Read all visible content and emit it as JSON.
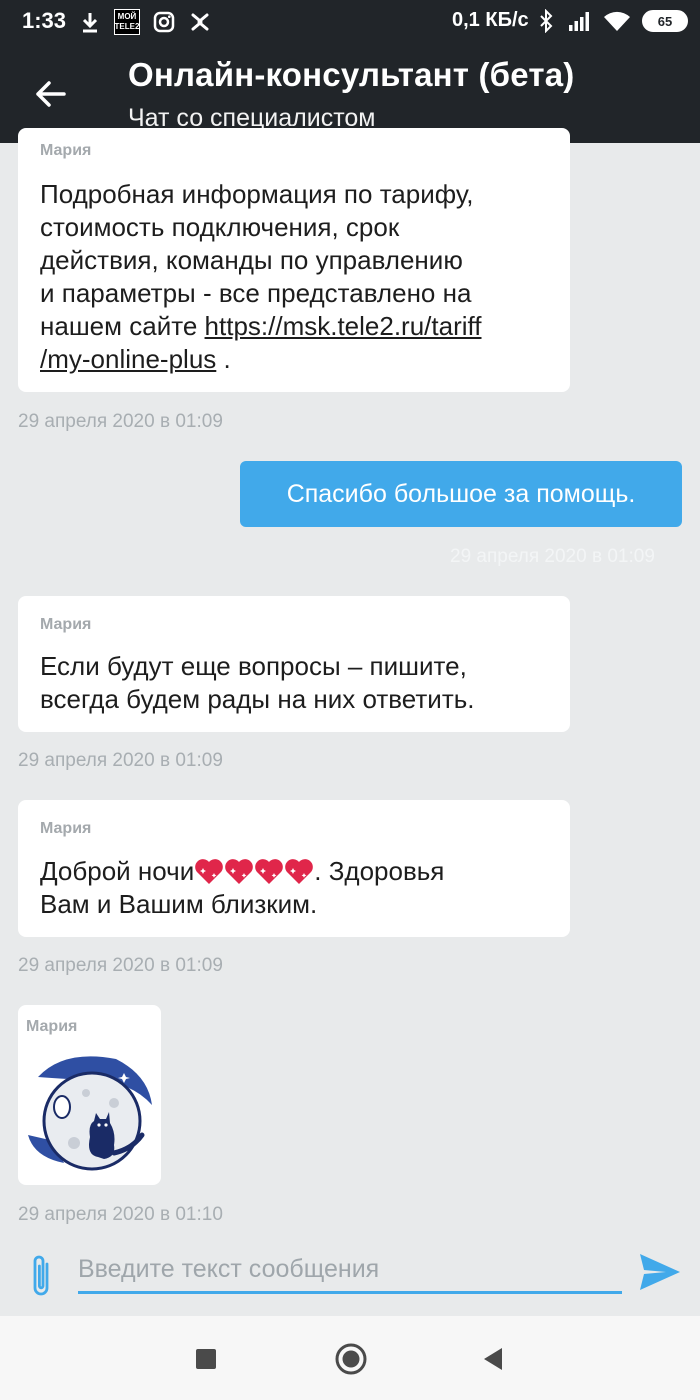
{
  "status_bar": {
    "time": "1:33",
    "operator_badge": "МОЙ TELE2",
    "network_speed": "0,1 КБ/с",
    "battery": "65"
  },
  "app_bar": {
    "title": "Онлайн-консультант (бета)",
    "subtitle": "Чат со специалистом"
  },
  "messages": [
    {
      "sender": "Мария",
      "text_line_1": "Подробная информация по тарифу,",
      "text_line_2": "стоимость  подключения, срок",
      "text_line_3": "действия, команды по управлению",
      "text_line_4": "и  параметры - все представлено на",
      "text_line_5_prefix": "нашем сайте ",
      "link_part_1": "https://msk.tele2.ru/tariff",
      "link_part_2": "/my-online-plus",
      "text_suffix": " .",
      "time": "29 апреля 2020 в 01:09"
    },
    {
      "text": "Спасибо большое за помощь.",
      "time": "29 апреля 2020 в 01:09"
    },
    {
      "sender": "Мария",
      "text_line_1": "Если будут еще вопросы – пишите,",
      "text_line_2": "всегда будем рады на них ответить.",
      "time": "29 апреля 2020 в 01:09"
    },
    {
      "sender": "Мария",
      "text_prefix": "Доброй ночи",
      "text_suffix": ". Здоровья",
      "text_line_2": "Вам и Вашим близким.",
      "time": "29 апреля 2020 в 01:09"
    },
    {
      "sender": "Мария",
      "sticker": "cat-on-moon-sticker",
      "time": "29 апреля 2020 в 01:10"
    }
  ],
  "composer": {
    "placeholder": "Введите текст сообщения"
  },
  "colors": {
    "app_bar": "#212529",
    "outgoing_bubble": "#41a9ea",
    "chat_background": "#e8eaeb"
  }
}
